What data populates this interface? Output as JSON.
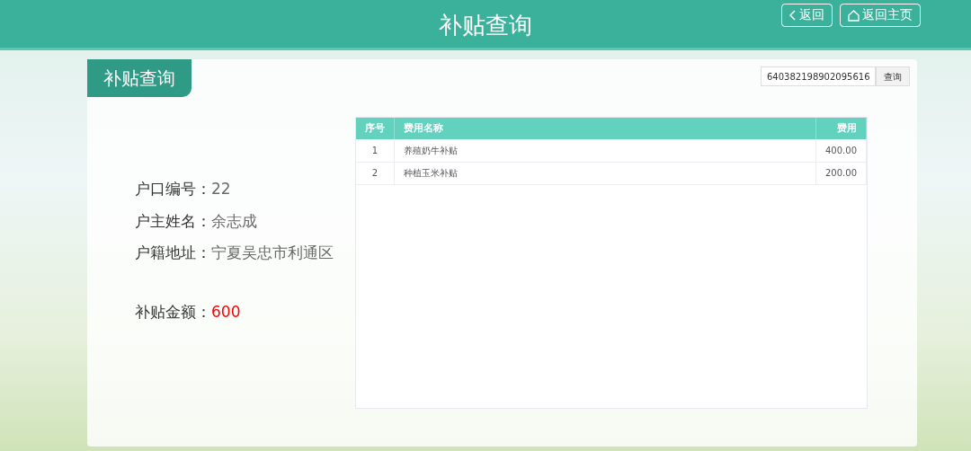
{
  "header": {
    "title": "补贴查询",
    "buttons": [
      {
        "kind": "back",
        "label": "返回"
      },
      {
        "kind": "home",
        "label": "返回主页"
      }
    ]
  },
  "panel": {
    "tab_label": "补贴查询",
    "search": {
      "value": "640382198902095616",
      "button": "查询"
    }
  },
  "info": [
    {
      "kind": "plain",
      "label": "户口编号：",
      "value": "22"
    },
    {
      "kind": "plain",
      "label": "户主姓名：",
      "value": "余志成"
    },
    {
      "kind": "plain",
      "label": "户籍地址：",
      "value": "宁夏吴忠市利通区"
    },
    {
      "kind": "amount",
      "label": "补贴金额：",
      "value": "600"
    }
  ],
  "table": {
    "columns": [
      "序号",
      "费用名称",
      "费用"
    ],
    "rows": [
      [
        "1",
        "养殖奶牛补贴",
        "400.00"
      ],
      [
        "2",
        "种植玉米补贴",
        "200.00"
      ]
    ]
  }
}
